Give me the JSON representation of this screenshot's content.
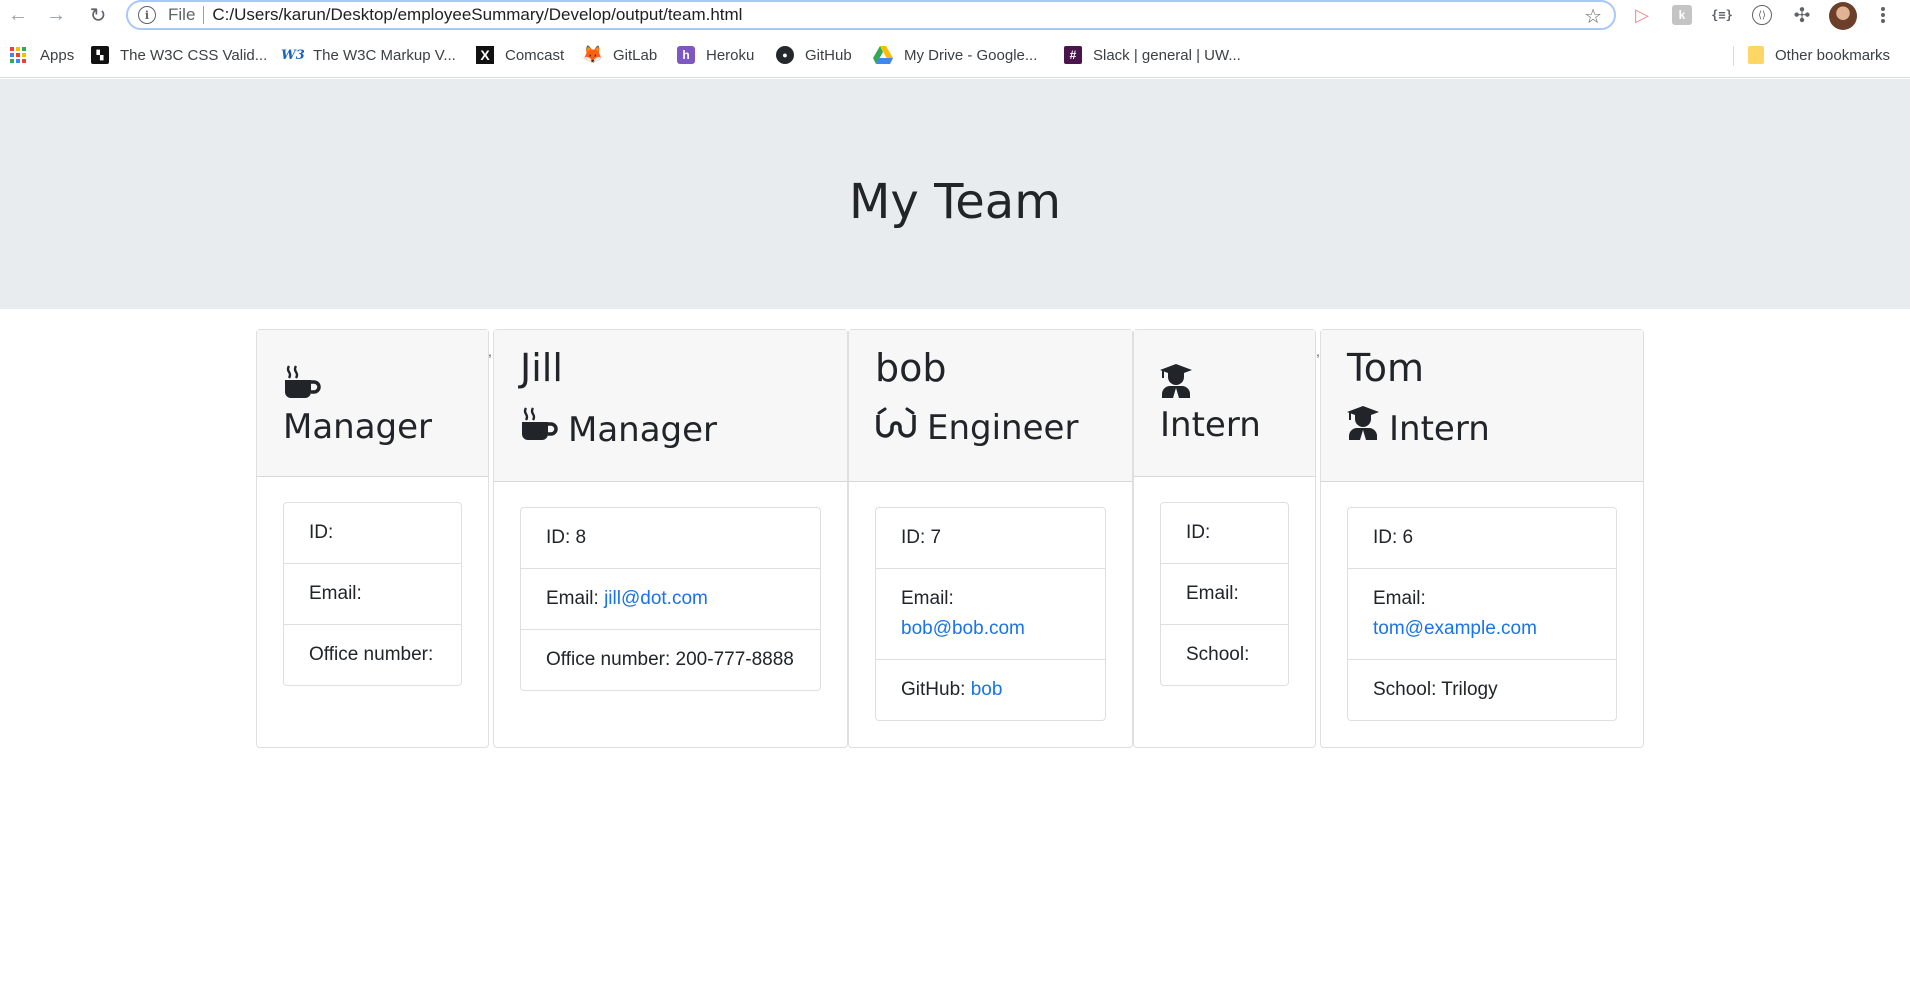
{
  "browser": {
    "scheme_label": "File",
    "url": "C:/Users/karun/Desktop/employeeSummary/Develop/output/team.html",
    "bookmarks": [
      {
        "label": "Apps",
        "icon": "apps-grid-icon"
      },
      {
        "label": "The W3C CSS Valid...",
        "icon": "w3c-css-icon"
      },
      {
        "label": "The W3C Markup V...",
        "icon": "w3c-markup-icon"
      },
      {
        "label": "Comcast",
        "icon": "comcast-icon"
      },
      {
        "label": "GitLab",
        "icon": "gitlab-icon"
      },
      {
        "label": "Heroku",
        "icon": "heroku-icon"
      },
      {
        "label": "GitHub",
        "icon": "github-icon"
      },
      {
        "label": "My Drive - Google...",
        "icon": "google-drive-icon"
      },
      {
        "label": "Slack | general | UW...",
        "icon": "slack-icon"
      }
    ],
    "other_bookmarks": "Other bookmarks"
  },
  "page": {
    "title": "My Team"
  },
  "cards": [
    {
      "role": "Manager",
      "role_icon": "mug-icon",
      "rows": [
        {
          "label": "ID:",
          "value": ""
        },
        {
          "label": "Email:",
          "value": ""
        },
        {
          "label": "Office number:",
          "value": ""
        }
      ]
    },
    {
      "name": "Jill",
      "role": "Manager",
      "role_icon": "mug-icon",
      "id_text": "ID: 8",
      "email_label": "Email: ",
      "email": "jill@dot.com",
      "extra_text": "Office number: 200-777-8888"
    },
    {
      "name": "bob",
      "role": "Engineer",
      "role_icon": "glasses-icon",
      "id_text": "ID: 7",
      "email_label": "Email: ",
      "email": "bob@bob.com",
      "extra_label": "GitHub: ",
      "extra_link": "bob"
    },
    {
      "role": "Intern",
      "role_icon": "graduate-icon",
      "rows": [
        {
          "label": "ID:"
        },
        {
          "label": "Email:"
        },
        {
          "label": "School:"
        }
      ]
    },
    {
      "name": "Tom",
      "role": "Intern",
      "role_icon": "graduate-icon",
      "id_text": "ID: 6",
      "email_label": "Email: ",
      "email": "tom@example.com",
      "extra_text": "School: Trilogy"
    }
  ],
  "colors": {
    "jumbotron_bg": "#e9ecef",
    "link": "#1a73e8",
    "card_header_bg": "#f7f7f7"
  }
}
